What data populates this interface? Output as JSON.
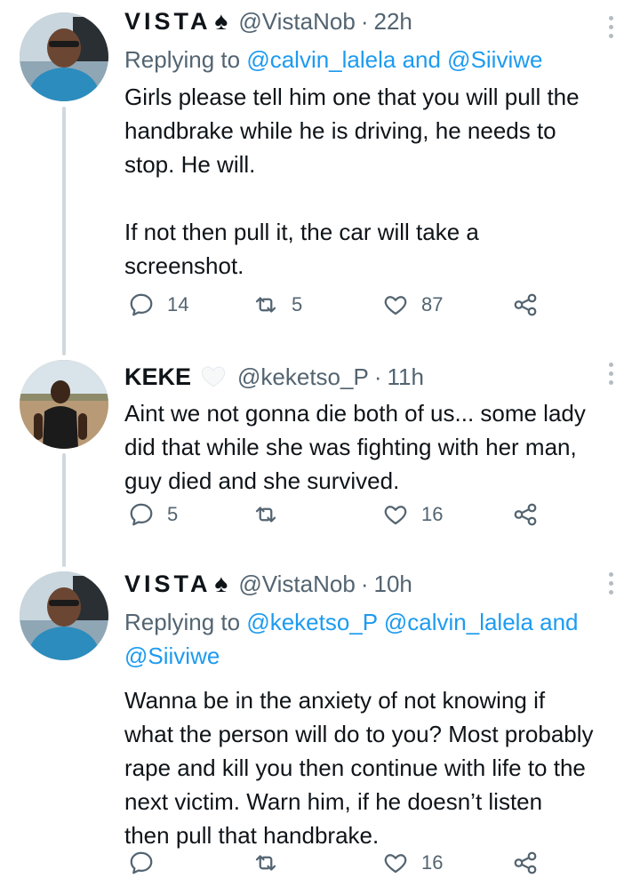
{
  "tweets": [
    {
      "name": "VISTA",
      "name_suffix": "♠",
      "handle": "@VistaNob",
      "time": "22h",
      "reply_prefix": "Replying to",
      "reply_to": "@calvin_lalela and @Siiviwe",
      "body_lines": [
        "Girls please tell him one that you will pull the",
        "handbrake while he is driving, he needs to",
        "stop. He will.",
        "",
        "If not then pull it, the car will take a",
        "screenshot."
      ],
      "replies": "14",
      "retweets": "5",
      "likes": "87"
    },
    {
      "name": "KEKE",
      "name_suffix": "🤍",
      "handle": "@keketso_P",
      "time": "11h",
      "body_lines": [
        "Aint we not gonna die both of us... some lady",
        "did that while she was fighting with her man,",
        "guy died and she survived."
      ],
      "replies": "5",
      "retweets": "",
      "likes": "16"
    },
    {
      "name": "VISTA",
      "name_suffix": "♠",
      "handle": "@VistaNob",
      "time": "10h",
      "reply_prefix": "Replying to",
      "reply_to_line1": "@keketso_P @calvin_lalela and",
      "reply_to_line2": "@Siiviwe",
      "body_lines": [
        "Wanna be in the anxiety of not knowing if",
        "what the person will do to you? Most probably",
        "rape and kill you then continue with life to the",
        "next victim. Warn him, if he doesn’t listen",
        "then pull that handbrake."
      ],
      "replies": "",
      "retweets": "",
      "likes": "16"
    }
  ],
  "separator": "·",
  "colors": {
    "link": "#1d9bf0",
    "secondary": "#536471",
    "text": "#0f1419",
    "thread_line": "#cfd9de"
  },
  "icons": [
    "reply-icon",
    "retweet-icon",
    "like-icon",
    "share-icon",
    "more-icon",
    "spade-icon",
    "white-heart-icon"
  ]
}
